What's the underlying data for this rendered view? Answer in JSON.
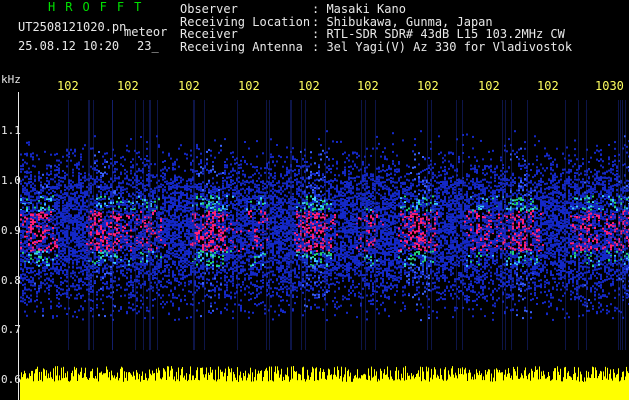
{
  "header": {
    "title": "HROFFT",
    "filename": "UT2508121020.pn",
    "meteor_label": "meteor",
    "datetime": "25.08.12 10:20",
    "minutes_label": "23_",
    "colors": {
      "title": "#00e000",
      "text": "#e8e8e8",
      "ticks": "#ffff60"
    }
  },
  "info": [
    {
      "label": "Observer",
      "value": ": Masaki Kano"
    },
    {
      "label": "Receiving Location",
      "value": ": Shibukawa, Gunma, Japan"
    },
    {
      "label": "Receiver",
      "value": ": RTL-SDR SDR# 43dB L15 103.2MHz CW"
    },
    {
      "label": "Receiving Antenna",
      "value": ": 3el Yagi(V) Az 330 for Vladivostok"
    }
  ],
  "yaxis": {
    "unit": "kHz",
    "labels": [
      "1.1",
      "1.0",
      "0.9",
      "0.8",
      "0.7",
      "0.6"
    ]
  },
  "xaxis": {
    "ticks": [
      "102",
      "102",
      "102",
      "102",
      "102",
      "102",
      "102",
      "102",
      "102",
      "1030"
    ]
  }
}
